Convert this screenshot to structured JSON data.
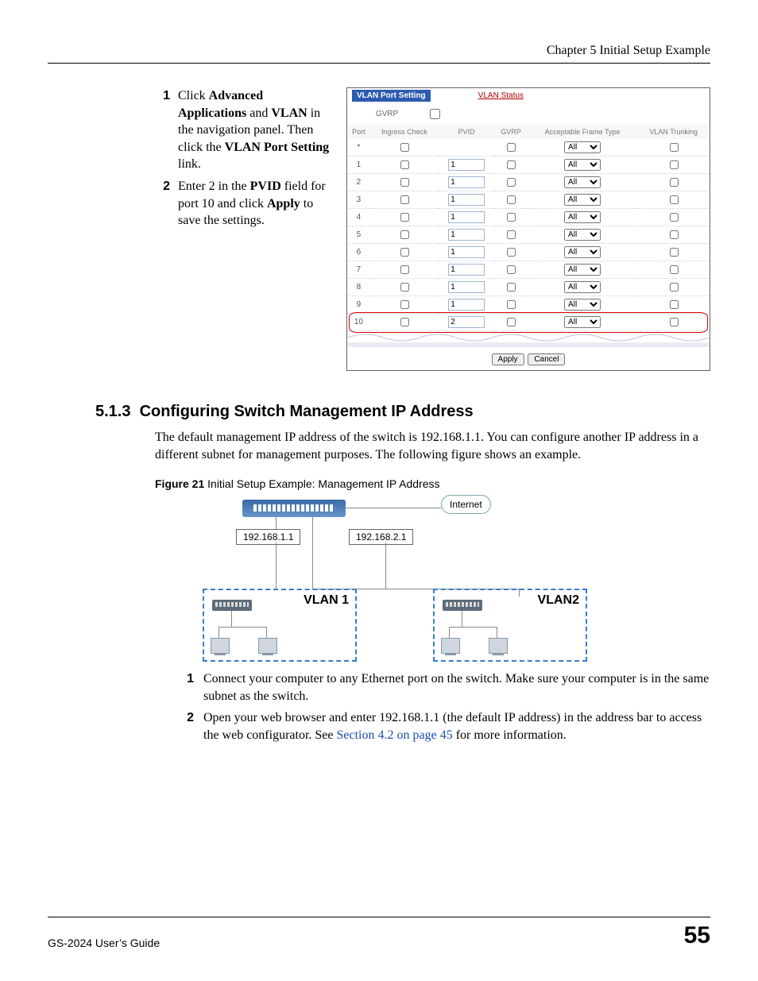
{
  "header": {
    "chapter": "Chapter 5 Initial Setup Example"
  },
  "steps_a": [
    {
      "n": "1",
      "html": "Click <b>Advanced Applications</b> and <b>VLAN</b> in the navigation panel. Then click the <b>VLAN Port Setting</b> link."
    },
    {
      "n": "2",
      "html": "Enter 2 in the <b>PVID</b> field for port 10 and click <b>Apply</b> to save the settings."
    }
  ],
  "screenshot": {
    "title": "VLAN Port Setting",
    "status_link": "VLAN Status",
    "gvrp_label": "GVRP",
    "columns": [
      "Port",
      "Ingress Check",
      "PVID",
      "GVRP",
      "Acceptable Frame Type",
      "VLAN Trunking"
    ],
    "frame_option": "All",
    "rows": [
      {
        "port": "*",
        "pvid": ""
      },
      {
        "port": "1",
        "pvid": "1"
      },
      {
        "port": "2",
        "pvid": "1"
      },
      {
        "port": "3",
        "pvid": "1"
      },
      {
        "port": "4",
        "pvid": "1"
      },
      {
        "port": "5",
        "pvid": "1"
      },
      {
        "port": "6",
        "pvid": "1"
      },
      {
        "port": "7",
        "pvid": "1"
      },
      {
        "port": "8",
        "pvid": "1"
      },
      {
        "port": "9",
        "pvid": "1"
      },
      {
        "port": "10",
        "pvid": "2",
        "highlight": true
      }
    ],
    "buttons": {
      "apply": "Apply",
      "cancel": "Cancel"
    }
  },
  "section": {
    "number": "5.1.3",
    "title": "Configuring Switch Management IP Address",
    "para": "The default management IP address of the switch is 192.168.1.1. You can configure another IP address in a different subnet for management purposes. The following figure shows an example."
  },
  "figure": {
    "label": "Figure 21",
    "title_rest": "   Initial Setup Example: Management IP Address",
    "internet": "Internet",
    "ip1": "192.168.1.1",
    "ip2": "192.168.2.1",
    "vlan1": "VLAN 1",
    "vlan2": "VLAN2"
  },
  "steps_b": [
    {
      "n": "1",
      "html": "Connect your computer to any Ethernet port on the switch. Make sure your computer is in the same subnet as the switch."
    },
    {
      "n": "2",
      "html": "Open your web browser and enter 192.168.1.1 (the default IP address) in the address bar to access the web configurator. See <span class='xref'>Section 4.2 on page 45</span> for more information."
    }
  ],
  "footer": {
    "guide": "GS-2024 User’s Guide",
    "page": "55"
  }
}
